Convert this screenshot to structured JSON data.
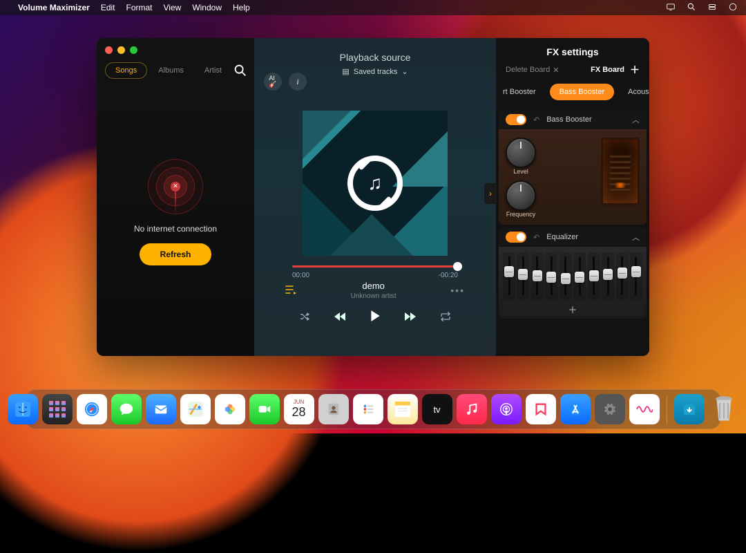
{
  "menubar": {
    "app_name": "Volume Maximizer",
    "items": [
      "Edit",
      "Format",
      "View",
      "Window",
      "Help"
    ]
  },
  "sidebar": {
    "tabs": [
      {
        "label": "Songs",
        "active": true
      },
      {
        "label": "Albums",
        "active": false
      },
      {
        "label": "Artist",
        "active": false
      }
    ],
    "no_conn_text": "No internet connection",
    "refresh_label": "Refresh"
  },
  "player": {
    "header": "Playback source",
    "source": "Saved tracks",
    "elapsed": "00:00",
    "remaining": "-00:20",
    "track_name": "demo",
    "track_artist": "Unknown artist"
  },
  "fx": {
    "title": "FX settings",
    "delete_label": "Delete Board",
    "board_label": "FX Board",
    "categories": [
      {
        "label": "rt Booster",
        "active": false,
        "partial": true
      },
      {
        "label": "Bass Booster",
        "active": true
      },
      {
        "label": "Acous",
        "active": false,
        "partial": true
      }
    ],
    "modules": [
      {
        "name": "Bass Booster",
        "enabled": true,
        "knobs": [
          "Level",
          "Frequency"
        ]
      },
      {
        "name": "Equalizer",
        "enabled": true
      }
    ]
  },
  "dock": {
    "calendar_day": "28"
  }
}
